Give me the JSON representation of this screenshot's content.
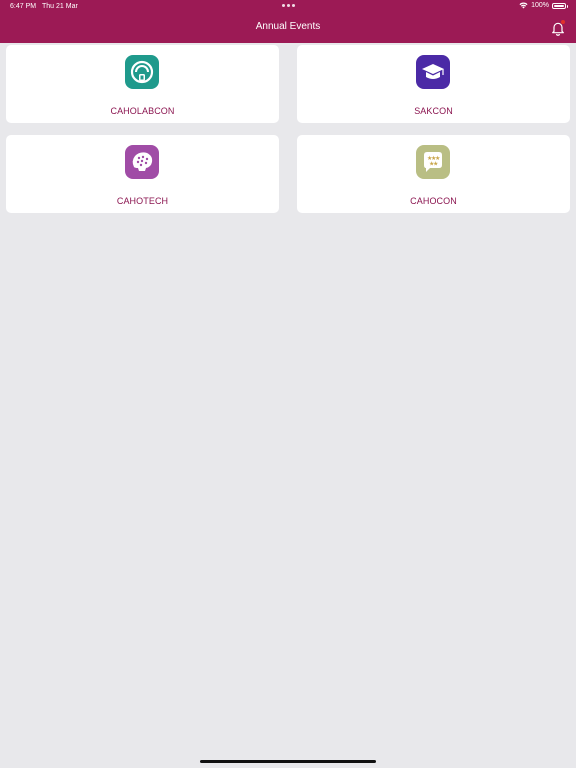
{
  "status_bar": {
    "time": "6:47 PM",
    "date": "Thu 21 Mar",
    "battery": "100%",
    "battery_level": 1.0
  },
  "header": {
    "title": "Annual Events",
    "background_color": "#9c1a55",
    "notification_icon": "bell-icon"
  },
  "events": [
    {
      "label": "CAHOLABCON",
      "icon": "lab-helmet-icon",
      "icon_color": "#1f9a8c"
    },
    {
      "label": "SAKCON",
      "icon": "graduation-cap-icon",
      "icon_color": "#4b2aa6"
    },
    {
      "label": "CAHOTECH",
      "icon": "brain-icon",
      "icon_color": "#a04ca6"
    },
    {
      "label": "CAHOCON",
      "icon": "star-chat-icon",
      "icon_color": "#b9be84"
    }
  ],
  "colors": {
    "background": "#e8e8eb",
    "card": "#ffffff",
    "label": "#8b1550"
  }
}
